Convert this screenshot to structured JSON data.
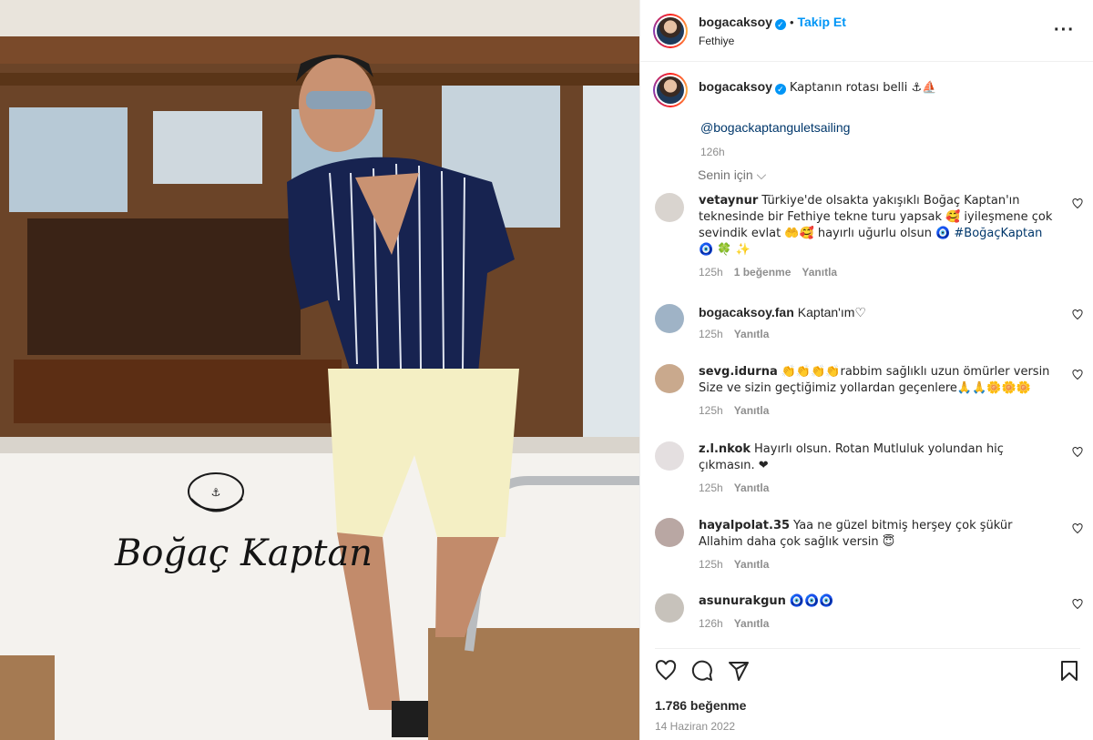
{
  "post": {
    "username": "bogacaksoy",
    "follow_label": "Takip Et",
    "location": "Fethiye",
    "caption_text": "Kaptanın rotası belli ⚓⛵",
    "mention": "@bogackaptanguletsailing",
    "caption_time": "126h",
    "sort_label": "Senin için ⌵",
    "photo_sign": "Boğaç Kaptan"
  },
  "comments": [
    {
      "user": "vetaynur",
      "text": "Türkiye'de olsakta yakışıklı Boğaç Kaptan'ın teknesinde bir Fethiye tekne turu yapsak 🥰 iyileşmene çok sevindik evlat 🤲🥰 hayırlı uğurlu olsun 🧿",
      "hashtag": "#BoğaçKaptan",
      "tail": "🧿 🍀 ✨",
      "time": "125h",
      "likes": "1 beğenme",
      "reply": "Yanıtla"
    },
    {
      "user": "bogacaksoy.fan",
      "text": "Kaptan'ım♡",
      "time": "125h",
      "reply": "Yanıtla"
    },
    {
      "user": "sevg.idurna",
      "text": "👏👏👏👏rabbim sağlıklı uzun ömürler versin Size ve sizin geçtiğimiz yollardan geçenlere🙏🙏🌼🌼🌼",
      "time": "125h",
      "reply": "Yanıtla"
    },
    {
      "user": "z.l.nkok",
      "text": "Hayırlı olsun. Rotan Mutluluk yolundan hiç çıkmasın. ❤",
      "time": "125h",
      "reply": "Yanıtla"
    },
    {
      "user": "hayalpolat.35",
      "text": "Yaa ne güzel bitmiş herşey çok şükür Allahim daha çok sağlık versin 😇",
      "time": "125h",
      "reply": "Yanıtla"
    },
    {
      "user": "asunurakgun",
      "text": "🧿🧿🧿",
      "time": "126h",
      "reply": "Yanıtla"
    }
  ],
  "footer": {
    "likes": "1.786 beğenme",
    "date": "14 Haziran 2022"
  },
  "colors": {
    "accent": "#0095f6",
    "link": "#00376b",
    "muted": "#8e8e8e"
  },
  "icons": [
    "more-icon",
    "heart-icon",
    "comment-icon",
    "share-icon",
    "bookmark-icon",
    "verified-icon"
  ]
}
